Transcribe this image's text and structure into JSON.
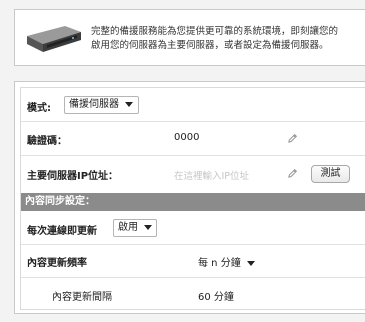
{
  "info": {
    "description_line1": "完整的備援服務能為您提供更可靠的系統環境，即刻讓您的",
    "description_line2": "啟用您的伺服器為主要伺服器，或者設定為備援伺服器。"
  },
  "settings": {
    "mode": {
      "label": "模式:",
      "selected": "備援伺服器"
    },
    "verification_code": {
      "label": "驗證碼：",
      "value": "0000"
    },
    "primary_server_ip": {
      "label": "主要伺服器IP位址：",
      "placeholder": "在這裡輸入IP位址",
      "test_label": "測試"
    },
    "sync_section": {
      "title": "內容同步設定：",
      "update_each_connection": {
        "label": "每次連線即更新",
        "selected": "啟用"
      },
      "update_frequency": {
        "label": "內容更新頻率",
        "selected": "每 n 分鐘"
      },
      "update_interval": {
        "label": "內容更新間隔",
        "value": "60 分鐘"
      }
    }
  }
}
